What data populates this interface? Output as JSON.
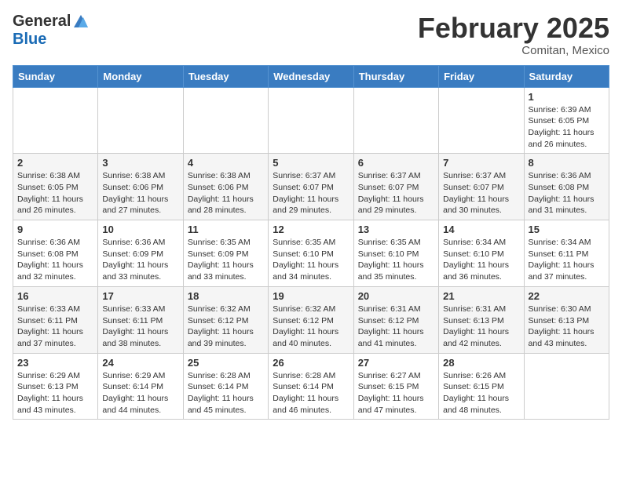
{
  "header": {
    "logo_general": "General",
    "logo_blue": "Blue",
    "month_title": "February 2025",
    "location": "Comitan, Mexico"
  },
  "days_of_week": [
    "Sunday",
    "Monday",
    "Tuesday",
    "Wednesday",
    "Thursday",
    "Friday",
    "Saturday"
  ],
  "weeks": [
    [
      {
        "day": "",
        "info": ""
      },
      {
        "day": "",
        "info": ""
      },
      {
        "day": "",
        "info": ""
      },
      {
        "day": "",
        "info": ""
      },
      {
        "day": "",
        "info": ""
      },
      {
        "day": "",
        "info": ""
      },
      {
        "day": "1",
        "info": "Sunrise: 6:39 AM\nSunset: 6:05 PM\nDaylight: 11 hours and 26 minutes."
      }
    ],
    [
      {
        "day": "2",
        "info": "Sunrise: 6:38 AM\nSunset: 6:05 PM\nDaylight: 11 hours and 26 minutes."
      },
      {
        "day": "3",
        "info": "Sunrise: 6:38 AM\nSunset: 6:06 PM\nDaylight: 11 hours and 27 minutes."
      },
      {
        "day": "4",
        "info": "Sunrise: 6:38 AM\nSunset: 6:06 PM\nDaylight: 11 hours and 28 minutes."
      },
      {
        "day": "5",
        "info": "Sunrise: 6:37 AM\nSunset: 6:07 PM\nDaylight: 11 hours and 29 minutes."
      },
      {
        "day": "6",
        "info": "Sunrise: 6:37 AM\nSunset: 6:07 PM\nDaylight: 11 hours and 29 minutes."
      },
      {
        "day": "7",
        "info": "Sunrise: 6:37 AM\nSunset: 6:07 PM\nDaylight: 11 hours and 30 minutes."
      },
      {
        "day": "8",
        "info": "Sunrise: 6:36 AM\nSunset: 6:08 PM\nDaylight: 11 hours and 31 minutes."
      }
    ],
    [
      {
        "day": "9",
        "info": "Sunrise: 6:36 AM\nSunset: 6:08 PM\nDaylight: 11 hours and 32 minutes."
      },
      {
        "day": "10",
        "info": "Sunrise: 6:36 AM\nSunset: 6:09 PM\nDaylight: 11 hours and 33 minutes."
      },
      {
        "day": "11",
        "info": "Sunrise: 6:35 AM\nSunset: 6:09 PM\nDaylight: 11 hours and 33 minutes."
      },
      {
        "day": "12",
        "info": "Sunrise: 6:35 AM\nSunset: 6:10 PM\nDaylight: 11 hours and 34 minutes."
      },
      {
        "day": "13",
        "info": "Sunrise: 6:35 AM\nSunset: 6:10 PM\nDaylight: 11 hours and 35 minutes."
      },
      {
        "day": "14",
        "info": "Sunrise: 6:34 AM\nSunset: 6:10 PM\nDaylight: 11 hours and 36 minutes."
      },
      {
        "day": "15",
        "info": "Sunrise: 6:34 AM\nSunset: 6:11 PM\nDaylight: 11 hours and 37 minutes."
      }
    ],
    [
      {
        "day": "16",
        "info": "Sunrise: 6:33 AM\nSunset: 6:11 PM\nDaylight: 11 hours and 37 minutes."
      },
      {
        "day": "17",
        "info": "Sunrise: 6:33 AM\nSunset: 6:11 PM\nDaylight: 11 hours and 38 minutes."
      },
      {
        "day": "18",
        "info": "Sunrise: 6:32 AM\nSunset: 6:12 PM\nDaylight: 11 hours and 39 minutes."
      },
      {
        "day": "19",
        "info": "Sunrise: 6:32 AM\nSunset: 6:12 PM\nDaylight: 11 hours and 40 minutes."
      },
      {
        "day": "20",
        "info": "Sunrise: 6:31 AM\nSunset: 6:12 PM\nDaylight: 11 hours and 41 minutes."
      },
      {
        "day": "21",
        "info": "Sunrise: 6:31 AM\nSunset: 6:13 PM\nDaylight: 11 hours and 42 minutes."
      },
      {
        "day": "22",
        "info": "Sunrise: 6:30 AM\nSunset: 6:13 PM\nDaylight: 11 hours and 43 minutes."
      }
    ],
    [
      {
        "day": "23",
        "info": "Sunrise: 6:29 AM\nSunset: 6:13 PM\nDaylight: 11 hours and 43 minutes."
      },
      {
        "day": "24",
        "info": "Sunrise: 6:29 AM\nSunset: 6:14 PM\nDaylight: 11 hours and 44 minutes."
      },
      {
        "day": "25",
        "info": "Sunrise: 6:28 AM\nSunset: 6:14 PM\nDaylight: 11 hours and 45 minutes."
      },
      {
        "day": "26",
        "info": "Sunrise: 6:28 AM\nSunset: 6:14 PM\nDaylight: 11 hours and 46 minutes."
      },
      {
        "day": "27",
        "info": "Sunrise: 6:27 AM\nSunset: 6:15 PM\nDaylight: 11 hours and 47 minutes."
      },
      {
        "day": "28",
        "info": "Sunrise: 6:26 AM\nSunset: 6:15 PM\nDaylight: 11 hours and 48 minutes."
      },
      {
        "day": "",
        "info": ""
      }
    ]
  ]
}
